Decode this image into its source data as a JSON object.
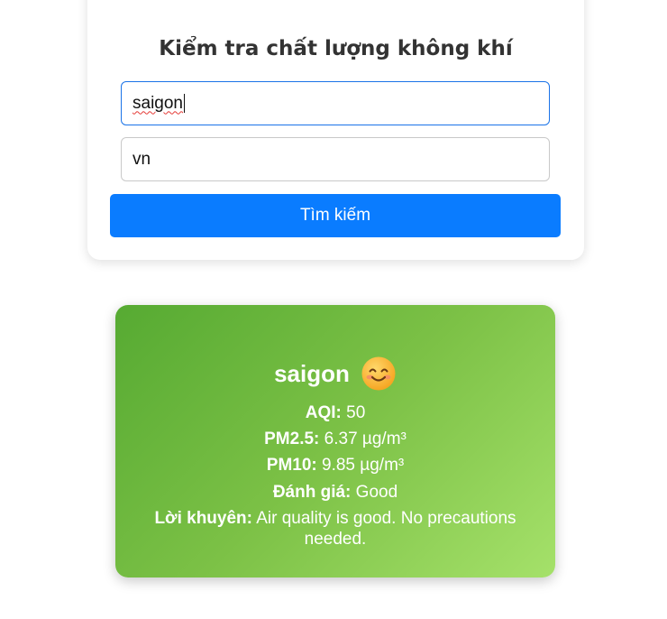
{
  "search": {
    "title": "Kiểm tra chất lượng không khí",
    "city_value": "saigon",
    "country_value": "vn",
    "button_label": "Tìm kiếm"
  },
  "result": {
    "city": "saigon",
    "status_icon": "smiling-face-icon",
    "aqi_label": "AQI:",
    "aqi_value": "50",
    "pm25_label": "PM2.5:",
    "pm25_value": "6.37 µg/m³",
    "pm10_label": "PM10:",
    "pm10_value": "9.85 µg/m³",
    "rating_label": "Đánh giá:",
    "rating_value": "Good",
    "advice_label": "Lời khuyên:",
    "advice_value": "Air quality is good. No precautions needed."
  },
  "colors": {
    "button": "#0a7cff",
    "card_gradient_start": "#56aa32",
    "card_gradient_end": "#a5e16a",
    "focus_border": "#1a73e8"
  }
}
